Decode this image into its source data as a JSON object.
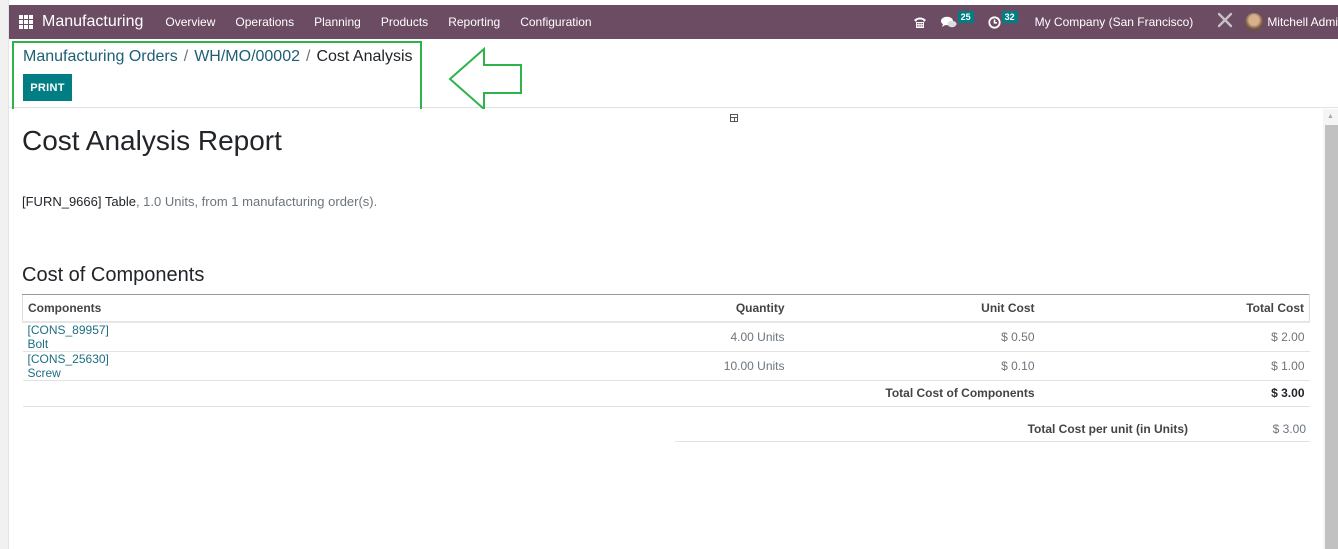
{
  "navbar": {
    "app_name": "Manufacturing",
    "menu": [
      "Overview",
      "Operations",
      "Planning",
      "Products",
      "Reporting",
      "Configuration"
    ],
    "messages_count": "25",
    "activities_count": "32",
    "company": "My Company (San Francisco)",
    "user": "Mitchell Admi",
    "icons": {
      "apps": "grid-icon",
      "phone": "phone-icon",
      "messages": "chat-icon",
      "activities": "clock-icon",
      "debug": "tools-icon"
    }
  },
  "control_panel": {
    "breadcrumb": [
      "Manufacturing Orders",
      "WH/MO/00002",
      "Cost Analysis"
    ],
    "separator": "/",
    "print_label": "PRINT"
  },
  "report": {
    "title": "Cost Analysis Report",
    "product": "[FURN_9666] Table",
    "summary_rest": ", 1.0 Units, from 1 manufacturing order(s).",
    "components_section": {
      "title": "Cost of Components",
      "columns": [
        "Components",
        "Quantity",
        "Unit Cost",
        "Total Cost"
      ],
      "rows": [
        {
          "component": "[CONS_89957] Bolt",
          "quantity": "4.00 Units",
          "unit_cost": "$ 0.50",
          "total_cost": "$ 2.00"
        },
        {
          "component": "[CONS_25630] Screw",
          "quantity": "10.00 Units",
          "unit_cost": "$ 0.10",
          "total_cost": "$ 1.00"
        }
      ],
      "total_label": "Total Cost of Components",
      "total_value": "$ 3.00"
    },
    "per_unit_label": "Total Cost per unit (in Units)",
    "per_unit_value": "$ 3.00"
  },
  "colors": {
    "navbar": "#6b4c62",
    "primary": "#017e84",
    "highlight": "#2fb24c"
  }
}
